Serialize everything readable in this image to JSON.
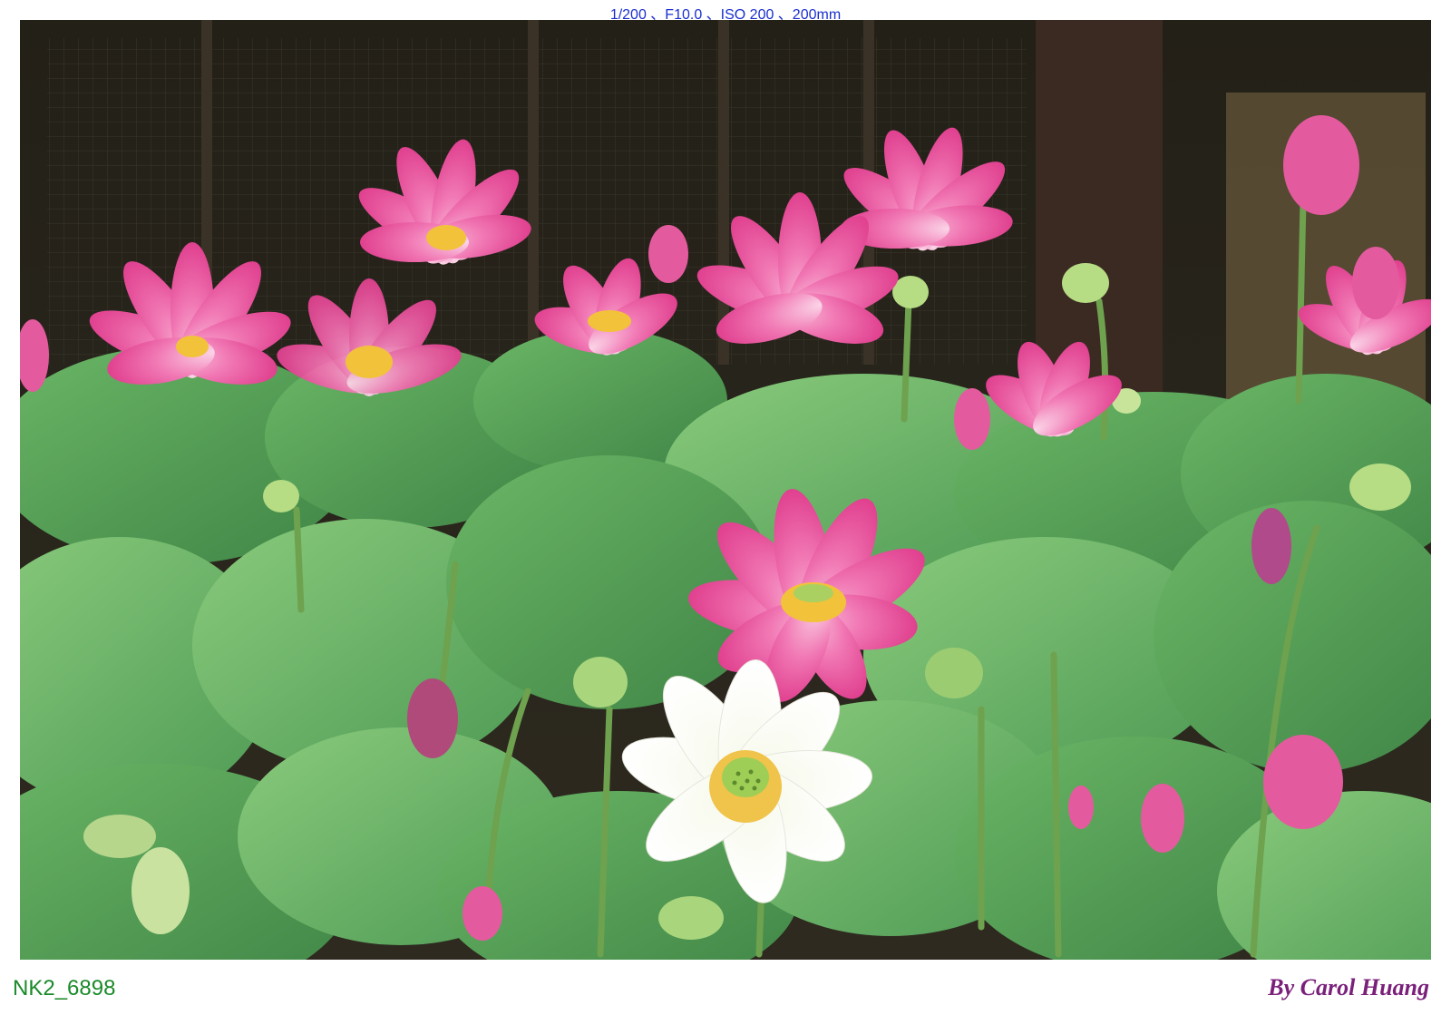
{
  "header": {
    "exif_text": "1/200 、F10.0 、ISO 200 、200mm"
  },
  "photo": {
    "subject": "lotus-pond",
    "colors": {
      "background": "#1b1a14",
      "leaf": "#4f9a52",
      "leaf_light": "#7cc072",
      "pink_petal": "#ea4c9c",
      "white_petal": "#ffffff",
      "stamen": "#f2c23a",
      "seed_pod": "#b6dc84"
    }
  },
  "footer": {
    "file_id": "NK2_6898",
    "credit": "By Carol Huang"
  },
  "colors": {
    "exif_text": "#1a2fd0",
    "file_id": "#1a8a2a",
    "credit": "#7a1f7a"
  }
}
